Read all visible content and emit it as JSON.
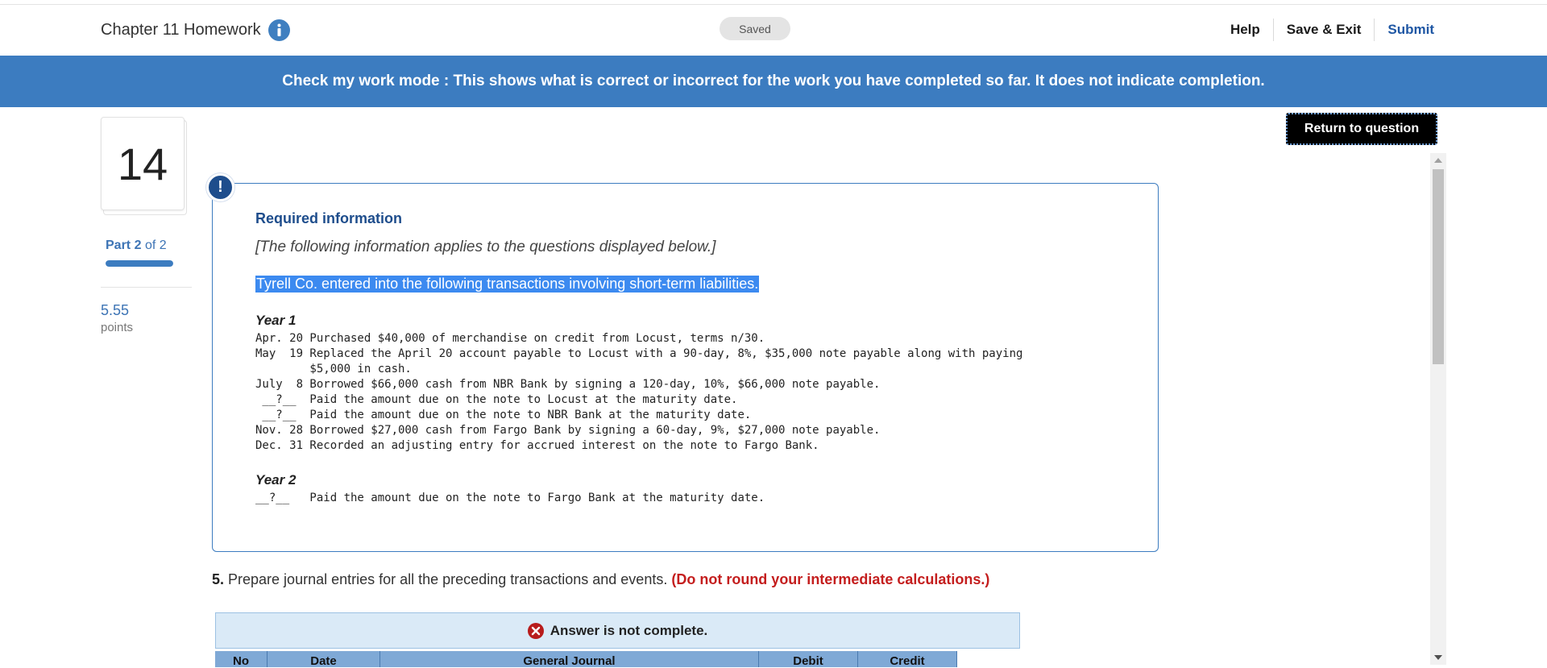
{
  "header": {
    "title": "Chapter 11 Homework",
    "saved": "Saved",
    "nav": {
      "help": "Help",
      "save_exit": "Save & Exit",
      "submit": "Submit"
    }
  },
  "banner": "Check my work mode : This shows what is correct or incorrect for the work you have completed so far. It does not indicate completion.",
  "sidebar": {
    "question_number": "14",
    "part_label": "Part",
    "part_current": "2",
    "part_total_text": "of 2",
    "progress_fraction": 1.0,
    "points_value": "5.55",
    "points_label": "points"
  },
  "return_button": "Return to question",
  "info_box": {
    "alert": "!",
    "title": "Required information",
    "applies": "[The following information applies to the questions displayed below.]",
    "intro": "Tyrell Co. entered into the following transactions involving short-term liabilities.",
    "year1_label": "Year 1",
    "year1_transactions": [
      "Apr. 20 Purchased $40,000 of merchandise on credit from Locust, terms n/30.",
      "May  19 Replaced the April 20 account payable to Locust with a 90-day, 8%, $35,000 note payable along with paying",
      "        $5,000 in cash.",
      "July  8 Borrowed $66,000 cash from NBR Bank by signing a 120-day, 10%, $66,000 note payable.",
      " __?__  Paid the amount due on the note to Locust at the maturity date.",
      " __?__  Paid the amount due on the note to NBR Bank at the maturity date.",
      "Nov. 28 Borrowed $27,000 cash from Fargo Bank by signing a 60-day, 9%, $27,000 note payable.",
      "Dec. 31 Recorded an adjusting entry for accrued interest on the note to Fargo Bank."
    ],
    "year2_label": "Year 2",
    "year2_transactions": [
      "__?__   Paid the amount due on the note to Fargo Bank at the maturity date."
    ]
  },
  "question": {
    "number": "5.",
    "text": " Prepare journal entries for all the preceding transactions and events. ",
    "note": "(Do not round your intermediate calculations.)"
  },
  "answer_status": "Answer is not complete.",
  "journal_table": {
    "headers": [
      "No",
      "Date",
      "General Journal",
      "Debit",
      "Credit"
    ]
  },
  "colors": {
    "banner": "#3c7cc0",
    "brand_dark": "#1e4d8c",
    "error_red": "#c41e1e",
    "selection": "#3c8af0"
  },
  "icons": [
    "info-icon",
    "alert-icon",
    "x-circle-icon",
    "chevron-up-icon",
    "chevron-down-icon"
  ]
}
